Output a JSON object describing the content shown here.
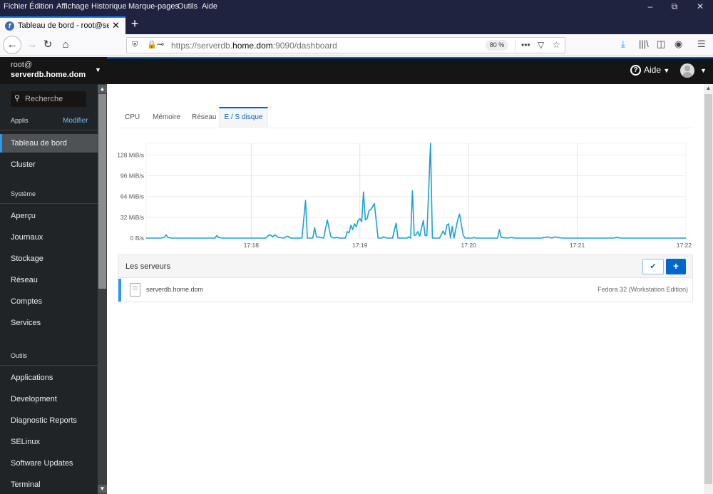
{
  "browser": {
    "menu": [
      "Fichier",
      "Édition",
      "Affichage",
      "Historique",
      "Marque-pages",
      "Outils",
      "Aide"
    ],
    "tab_title": "Tableau de bord - root@serverdb.home.dom",
    "tab_favicon": "fedora-logo-icon",
    "url_prefix": "https://serverdb.",
    "url_domain": "home.dom",
    "url_suffix": ":9090/dashboard",
    "zoom_level": "80 %",
    "window_controls": [
      "minimize",
      "restore",
      "close"
    ]
  },
  "header": {
    "help_label": "Aide",
    "user_avatar": "avatar-icon"
  },
  "sidebar": {
    "user": "root@",
    "host": "serverdb.home.dom",
    "search_placeholder": "Recherche",
    "apps_section": "Applis",
    "modify_label": "Modifier",
    "apps_items": [
      {
        "label": "Tableau de bord",
        "active": true
      },
      {
        "label": "Cluster",
        "active": false
      }
    ],
    "system_section": "Système",
    "system_items": [
      {
        "label": "Aperçu"
      },
      {
        "label": "Journaux"
      },
      {
        "label": "Stockage"
      },
      {
        "label": "Réseau"
      },
      {
        "label": "Comptes"
      },
      {
        "label": "Services"
      }
    ],
    "tools_section": "Outils",
    "tools_items": [
      {
        "label": "Applications"
      },
      {
        "label": "Development"
      },
      {
        "label": "Diagnostic Reports"
      },
      {
        "label": "SELinux"
      },
      {
        "label": "Software Updates"
      },
      {
        "label": "Terminal"
      }
    ]
  },
  "main": {
    "tabs": [
      {
        "label": "CPU",
        "active": false
      },
      {
        "label": "Mémoire",
        "active": false
      },
      {
        "label": "Réseau",
        "active": false
      },
      {
        "label": "E / S disque",
        "active": true
      }
    ],
    "servers": {
      "title": "Les serveurs",
      "rows": [
        {
          "name": "serverdb.home.dom",
          "os": "Fedora 32 (Workstation Edition)",
          "color": "#2b9af3"
        }
      ]
    }
  },
  "chart_data": {
    "type": "line",
    "title": "",
    "xlabel": "",
    "ylabel": "",
    "y_unit": "MiB/s",
    "ylim": [
      0,
      146
    ],
    "yticks": [
      0,
      32,
      64,
      96,
      128
    ],
    "ytick_labels": [
      "0 B/s",
      "32 MiB/s",
      "64 MiB/s",
      "96 MiB/s",
      "128 MiB/s"
    ],
    "x_unit": "seconds since 17:17:00",
    "xlim": [
      2,
      300
    ],
    "xticks": [
      60,
      120,
      180,
      240,
      300
    ],
    "xtick_labels": [
      "17:18",
      "17:19",
      "17:20",
      "17:21",
      "17:22"
    ],
    "grid": true,
    "line_color": "#06c",
    "series": [
      {
        "name": "serverdb.home.dom",
        "points": [
          [
            2,
            0
          ],
          [
            10,
            0
          ],
          [
            12,
            1
          ],
          [
            13,
            5
          ],
          [
            14,
            1
          ],
          [
            16,
            0
          ],
          [
            40,
            0
          ],
          [
            41,
            4
          ],
          [
            42,
            1
          ],
          [
            44,
            0
          ],
          [
            68,
            0
          ],
          [
            70,
            5
          ],
          [
            71,
            4
          ],
          [
            72,
            2
          ],
          [
            73,
            5
          ],
          [
            75,
            1
          ],
          [
            78,
            0
          ],
          [
            80,
            3
          ],
          [
            82,
            0
          ],
          [
            88,
            0
          ],
          [
            90,
            58
          ],
          [
            91,
            0
          ],
          [
            94,
            0
          ],
          [
            95,
            16
          ],
          [
            96,
            2
          ],
          [
            100,
            0
          ],
          [
            102,
            28
          ],
          [
            104,
            2
          ],
          [
            106,
            0
          ],
          [
            107,
            1
          ],
          [
            109,
            0
          ],
          [
            112,
            0
          ],
          [
            113,
            10
          ],
          [
            114,
            8
          ],
          [
            115,
            20
          ],
          [
            116,
            13
          ],
          [
            117,
            22
          ],
          [
            118,
            17
          ],
          [
            119,
            27
          ],
          [
            120,
            30
          ],
          [
            121,
            25
          ],
          [
            122,
            71
          ],
          [
            123,
            28
          ],
          [
            124,
            30
          ],
          [
            125,
            42
          ],
          [
            126,
            44
          ],
          [
            127,
            48
          ],
          [
            128,
            53
          ],
          [
            130,
            0
          ],
          [
            132,
            0
          ],
          [
            133,
            2
          ],
          [
            135,
            0
          ],
          [
            138,
            0
          ],
          [
            140,
            23
          ],
          [
            141,
            0
          ],
          [
            146,
            0
          ],
          [
            147,
            2
          ],
          [
            148,
            0
          ],
          [
            149,
            73
          ],
          [
            150,
            4
          ],
          [
            151,
            5
          ],
          [
            152,
            10
          ],
          [
            153,
            3
          ],
          [
            155,
            27
          ],
          [
            156,
            4
          ],
          [
            157,
            4
          ],
          [
            159,
            146
          ],
          [
            160,
            0
          ],
          [
            164,
            0
          ],
          [
            166,
            11
          ],
          [
            167,
            5
          ],
          [
            168,
            20
          ],
          [
            169,
            22
          ],
          [
            170,
            0
          ],
          [
            171,
            18
          ],
          [
            172,
            0
          ],
          [
            174,
            28
          ],
          [
            175,
            37
          ],
          [
            177,
            5
          ],
          [
            178,
            0
          ],
          [
            182,
            0
          ],
          [
            183,
            1
          ],
          [
            184,
            0
          ],
          [
            186,
            0
          ],
          [
            196,
            0
          ],
          [
            197,
            13
          ],
          [
            198,
            1
          ],
          [
            202,
            0
          ],
          [
            203,
            1
          ],
          [
            206,
            0
          ],
          [
            220,
            0
          ],
          [
            224,
            2
          ],
          [
            226,
            0
          ],
          [
            228,
            2
          ],
          [
            229,
            1
          ],
          [
            232,
            0
          ],
          [
            260,
            0
          ],
          [
            262,
            1
          ],
          [
            264,
            0
          ],
          [
            300,
            0
          ]
        ]
      }
    ]
  }
}
